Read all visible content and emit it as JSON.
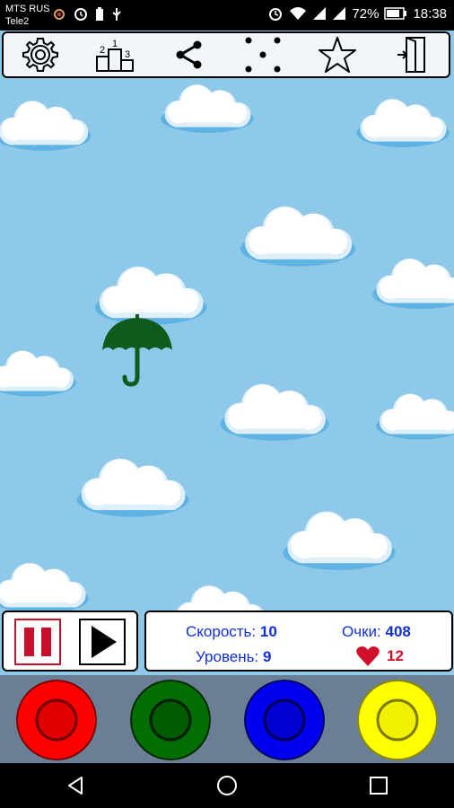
{
  "status_bar": {
    "carrier_1": "MTS RUS",
    "carrier_2": "Tele2",
    "battery_percent": "72%",
    "time": "18:38",
    "icons": [
      "flower-app-icon",
      "data-saver-icon",
      "battery-app-icon",
      "usb-icon",
      "alarm-icon",
      "wifi-icon",
      "signal-icon",
      "signal-icon",
      "battery-icon"
    ]
  },
  "toolbar": {
    "buttons": [
      {
        "icon": "gear-icon",
        "name": "settings-button"
      },
      {
        "icon": "podium-icon",
        "name": "leaderboard-button",
        "digits": [
          "2",
          "1",
          "3"
        ]
      },
      {
        "icon": "share-icon",
        "name": "share-button"
      },
      {
        "icon": "dots-icon",
        "name": "more-games-button"
      },
      {
        "icon": "star-icon",
        "name": "rate-button"
      },
      {
        "icon": "exit-door-icon",
        "name": "exit-button"
      }
    ]
  },
  "game": {
    "falling_object": "umbrella",
    "falling_object_color": "#0f5a1c",
    "sky_color": "#8fc9ea"
  },
  "stats": {
    "speed_label": "Скорость:",
    "speed_value": "10",
    "score_label": "Очки:",
    "score_value": "408",
    "level_label": "Уровень:",
    "level_value": "9",
    "lives_value": "12",
    "lives_icon": "heart-icon"
  },
  "color_buttons": [
    {
      "name": "red-button",
      "color": "#ff0000"
    },
    {
      "name": "green-button",
      "color": "#006e00"
    },
    {
      "name": "blue-button",
      "color": "#0000ee"
    },
    {
      "name": "yellow-button",
      "color": "#ffff00"
    }
  ],
  "nav": {
    "icons": [
      "back-icon",
      "home-icon",
      "recents-icon"
    ]
  }
}
